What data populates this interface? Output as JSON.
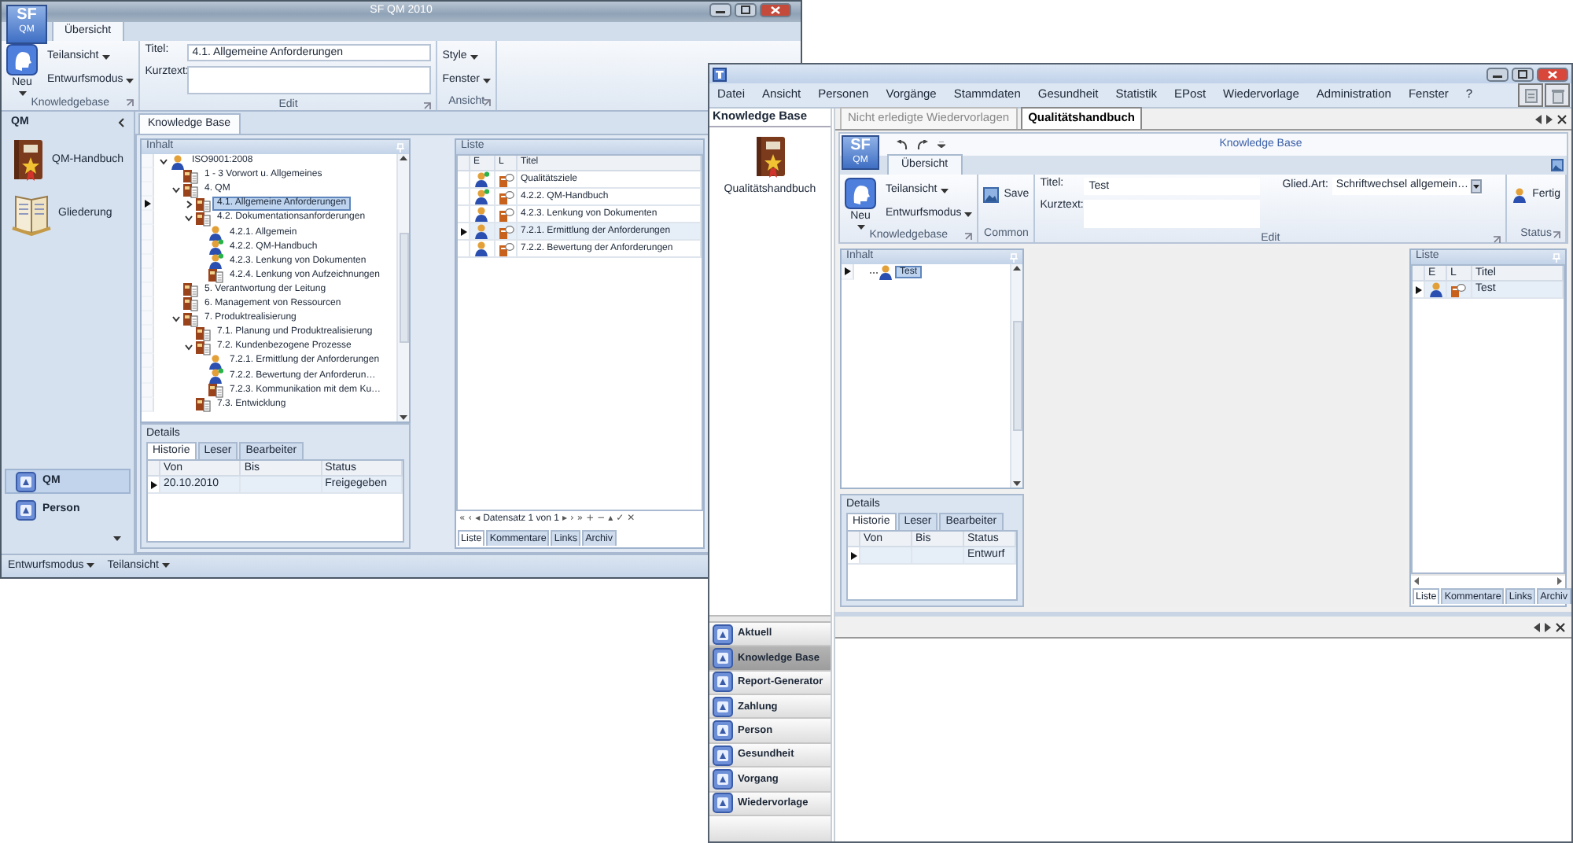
{
  "back_window": {
    "title": "SF QM 2010",
    "logo": [
      "SF",
      "QM"
    ],
    "ribbon_tabs": [
      {
        "label": "Übersicht",
        "selected": true
      }
    ],
    "ribbon_groups": [
      {
        "kind": "knowledgebase",
        "label": "Knowledgebase",
        "launcher": true,
        "button": "Neu",
        "menus": [
          "Teilansicht",
          "Entwurfsmodus"
        ]
      },
      {
        "kind": "edit",
        "label": "Edit",
        "launcher": true,
        "fields": [
          {
            "label": "Titel:",
            "value": "4.1. Allgemeine Anforderungen"
          },
          {
            "label": "Kurztext:"
          }
        ]
      },
      {
        "kind": "menus",
        "label": "Ansicht",
        "launcher": true,
        "menus": [
          "Style",
          "Fenster"
        ]
      }
    ],
    "nav": {
      "title": "QM",
      "items": [
        {
          "label": "QM-Handbuch",
          "kind": "book"
        },
        {
          "label": "Gliederung",
          "kind": "binder"
        }
      ],
      "buttons": [
        {
          "label": "QM",
          "selected": true
        },
        {
          "label": "Person",
          "selected": false
        }
      ]
    },
    "doc_tabs": [
      {
        "label": "Knowledge Base",
        "selected": true
      }
    ],
    "tree": {
      "title": "Inhalt",
      "nodes": [
        {
          "label": "ISO9001:2008",
          "kind": "person",
          "expanded": true,
          "selected": false,
          "children": [
            {
              "label": "1 - 3 Vorwort u. Allgemeines",
              "kind": "chapter",
              "selected": false
            },
            {
              "label": "4. QM",
              "kind": "chapter",
              "expanded": true,
              "selected": false,
              "children": [
                {
                  "label": "4.1. Allgemeine Anforderungen",
                  "kind": "chapter",
                  "expanded": false,
                  "selected": true
                },
                {
                  "label": "4.2. Dokumentationsanforderungen",
                  "kind": "chapter",
                  "expanded": true,
                  "selected": false,
                  "children": [
                    {
                      "label": "4.2.1. Allgemein",
                      "kind": "person",
                      "selected": false
                    },
                    {
                      "label": "4.2.2. QM-Handbuch",
                      "kind": "person-new",
                      "selected": false
                    },
                    {
                      "label": "4.2.3. Lenkung von Dokumenten",
                      "kind": "person-new",
                      "selected": false
                    },
                    {
                      "label": "4.2.4. Lenkung von Aufzeichnungen",
                      "kind": "chapter",
                      "selected": false
                    }
                  ]
                }
              ]
            },
            {
              "label": "5. Verantwortung der Leitung",
              "kind": "chapter",
              "selected": false
            },
            {
              "label": "6. Management von Ressourcen",
              "kind": "chapter",
              "selected": false
            },
            {
              "label": "7. Produktrealisierung",
              "kind": "chapter",
              "expanded": true,
              "selected": false,
              "children": [
                {
                  "label": "7.1. Planung und Produktrealisierung",
                  "kind": "chapter",
                  "selected": false
                },
                {
                  "label": "7.2. Kundenbezogene Prozesse",
                  "kind": "chapter",
                  "expanded": true,
                  "selected": false,
                  "children": [
                    {
                      "label": "7.2.1. Ermittlung der Anforderungen",
                      "kind": "person",
                      "selected": false
                    },
                    {
                      "label": "7.2.2. Bewertung der Anforderun…",
                      "kind": "person-new",
                      "selected": false
                    },
                    {
                      "label": "7.2.3. Kommunikation mit dem Ku…",
                      "kind": "chapter",
                      "selected": false
                    }
                  ]
                },
                {
                  "label": "7.3. Entwicklung",
                  "kind": "chapter",
                  "selected": false
                }
              ]
            }
          ]
        }
      ]
    },
    "details": {
      "title": "Details",
      "tabs": [
        {
          "label": "Historie",
          "selected": true
        },
        {
          "label": "Leser",
          "selected": false
        },
        {
          "label": "Bearbeiter",
          "selected": false
        }
      ],
      "columns": [
        "Von",
        "Bis",
        "Status"
      ],
      "rows": [
        {
          "von": "20.10.2010",
          "status": "Freigegeben",
          "selected": true
        }
      ]
    },
    "list": {
      "title": "Liste",
      "columns": [
        "E",
        "L",
        "Titel"
      ],
      "rows": [
        {
          "kind": "person-new",
          "title": "Qualitätsziele",
          "selected": false
        },
        {
          "kind": "person-new",
          "title": "4.2.2. QM-Handbuch",
          "selected": false
        },
        {
          "kind": "person",
          "title": "4.2.3. Lenkung von Dokumenten",
          "selected": false
        },
        {
          "kind": "person",
          "title": "7.2.1. Ermittlung der Anforderungen",
          "selected": true
        },
        {
          "kind": "person",
          "title": "7.2.2. Bewertung der Anforderungen",
          "selected": false
        }
      ],
      "pager": "Datensatz 1 von 1",
      "pager_buttons_left": [
        "«",
        "‹",
        "◂"
      ],
      "pager_buttons_right": [
        "▸",
        "›",
        "»",
        "+",
        "−",
        "▴",
        "✓",
        "✕"
      ],
      "tabs": [
        {
          "label": "Liste",
          "selected": true
        },
        {
          "label": "Kommentare",
          "selected": false
        },
        {
          "label": "Links",
          "selected": false
        },
        {
          "label": "Archiv",
          "selected": false
        }
      ]
    },
    "status_bar": [
      "Entwurfsmodus",
      "Teilansicht"
    ]
  },
  "front_window": {
    "menu": [
      "Datei",
      "Ansicht",
      "Personen",
      "Vorgänge",
      "Stammdaten",
      "Gesundheit",
      "Statistik",
      "EPost",
      "Wiedervorlage",
      "Administration",
      "Fenster",
      "?"
    ],
    "nav": {
      "title": "Knowledge Base",
      "items": [
        {
          "label": "Qualitätshandbuch",
          "kind": "book"
        }
      ],
      "buttons": [
        {
          "label": "Aktuell",
          "selected": false
        },
        {
          "label": "Knowledge Base",
          "selected": true
        },
        {
          "label": "Report-Generator",
          "selected": false
        },
        {
          "label": "Zahlung",
          "selected": false
        },
        {
          "label": "Person",
          "selected": false
        },
        {
          "label": "Gesundheit",
          "selected": false
        },
        {
          "label": "Vorgang",
          "selected": false
        },
        {
          "label": "Wiedervorlage",
          "selected": false
        }
      ]
    },
    "doc_tabs": [
      {
        "label": "Nicht erledigte Wiedervorlagen",
        "selected": false
      },
      {
        "label": "Qualitätshandbuch",
        "selected": true
      }
    ],
    "logo": [
      "SF",
      "QM"
    ],
    "ribbon_title": "Knowledge Base",
    "ribbon_tabs": [
      {
        "label": "Übersicht",
        "selected": true
      }
    ],
    "ribbon_groups": [
      {
        "kind": "knowledgebase",
        "label": "Knowledgebase",
        "launcher": true,
        "button": "Neu",
        "menus": [
          "Teilansicht",
          "Entwurfsmodus"
        ]
      },
      {
        "kind": "buttons",
        "label": "Common",
        "launcher": false,
        "buttons": [
          {
            "label": "Save",
            "kind": "save"
          }
        ]
      },
      {
        "kind": "edit",
        "label": "Edit",
        "launcher": true,
        "fields": [
          {
            "label": "Titel:",
            "value": "Test"
          },
          {
            "label": "Kurztext:"
          }
        ],
        "select": {
          "label": "Glied.Art:",
          "value": "Schriftwechsel allgemein…"
        }
      },
      {
        "kind": "buttons",
        "label": "Status",
        "launcher": true,
        "buttons": [
          {
            "label": "Fertig",
            "kind": "person"
          }
        ]
      }
    ],
    "tree": {
      "title": "Inhalt",
      "nodes": [
        {
          "label": "Test",
          "kind": "person",
          "selected": true
        }
      ]
    },
    "details": {
      "title": "Details",
      "tabs": [
        {
          "label": "Historie",
          "selected": true
        },
        {
          "label": "Leser",
          "selected": false
        },
        {
          "label": "Bearbeiter",
          "selected": false
        }
      ],
      "columns": [
        "Von",
        "Bis",
        "Status"
      ],
      "rows": [
        {
          "status": "Entwurf",
          "selected": true
        }
      ]
    },
    "list": {
      "title": "Liste",
      "columns": [
        "E",
        "L",
        "Titel"
      ],
      "rows": [
        {
          "kind": "person",
          "title": "Test",
          "selected": true
        }
      ],
      "tabs": [
        {
          "label": "Liste",
          "selected": true
        },
        {
          "label": "Kommentare",
          "selected": false
        },
        {
          "label": "Links",
          "selected": false
        },
        {
          "label": "Archiv",
          "selected": false
        }
      ]
    }
  }
}
